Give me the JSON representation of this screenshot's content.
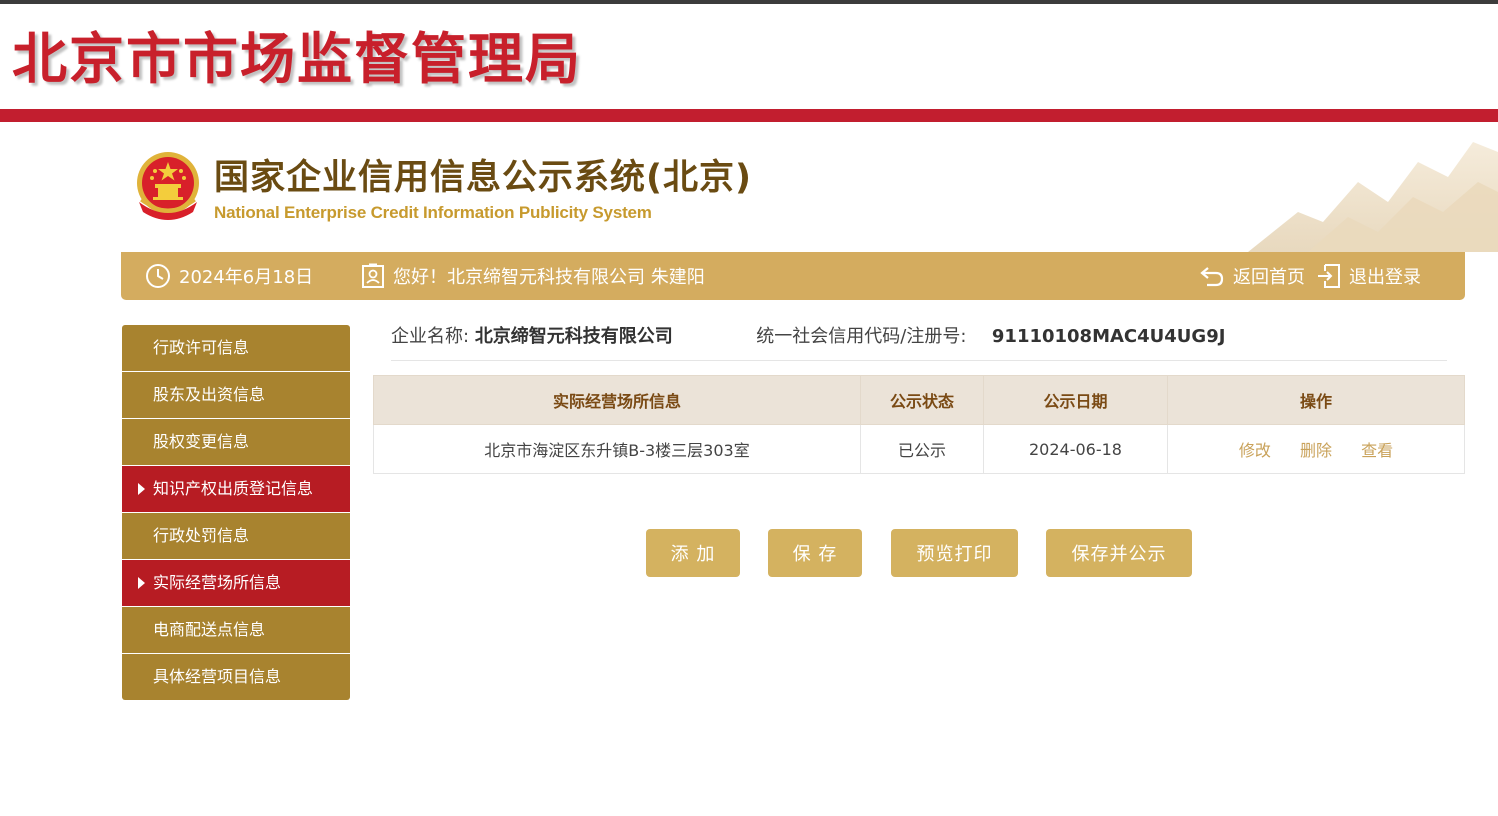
{
  "header": {
    "agency_title": "北京市市场监督管理局",
    "system_title_cn": "国家企业信用信息公示系统(北京)",
    "system_title_en": "National Enterprise Credit Information Publicity System"
  },
  "topbar": {
    "date": "2024年6月18日",
    "greeting": "您好！北京缔智元科技有限公司  朱建阳",
    "home_link": "返回首页",
    "logout_link": "退出登录"
  },
  "sidebar": {
    "items": [
      {
        "label": "行政许可信息",
        "active": false
      },
      {
        "label": "股东及出资信息",
        "active": false
      },
      {
        "label": "股权变更信息",
        "active": false
      },
      {
        "label": "知识产权出质登记信息",
        "active": true
      },
      {
        "label": "行政处罚信息",
        "active": false
      },
      {
        "label": "实际经营场所信息",
        "active": true
      },
      {
        "label": "电商配送点信息",
        "active": false
      },
      {
        "label": "具体经营项目信息",
        "active": false
      }
    ]
  },
  "company": {
    "name_label": "企业名称:",
    "name_value": "北京缔智元科技有限公司",
    "code_label": "统一社会信用代码/注册号:",
    "code_value": "91110108MAC4U4UG9J"
  },
  "table": {
    "headers": [
      "实际经营场所信息",
      "公示状态",
      "公示日期",
      "操作"
    ],
    "rows": [
      {
        "address": "北京市海淀区东升镇B-3楼三层303室",
        "status": "已公示",
        "date": "2024-06-18"
      }
    ],
    "actions": {
      "edit": "修改",
      "delete": "删除",
      "view": "查看"
    }
  },
  "buttons": {
    "add": "添 加",
    "save": "保 存",
    "preview": "预览打印",
    "save_publish": "保存并公示"
  },
  "colors": {
    "brand_red": "#c21e2f",
    "gold": "#d4ac5f",
    "sidebar_gold": "#a8832f",
    "sidebar_active": "#b71c23"
  }
}
